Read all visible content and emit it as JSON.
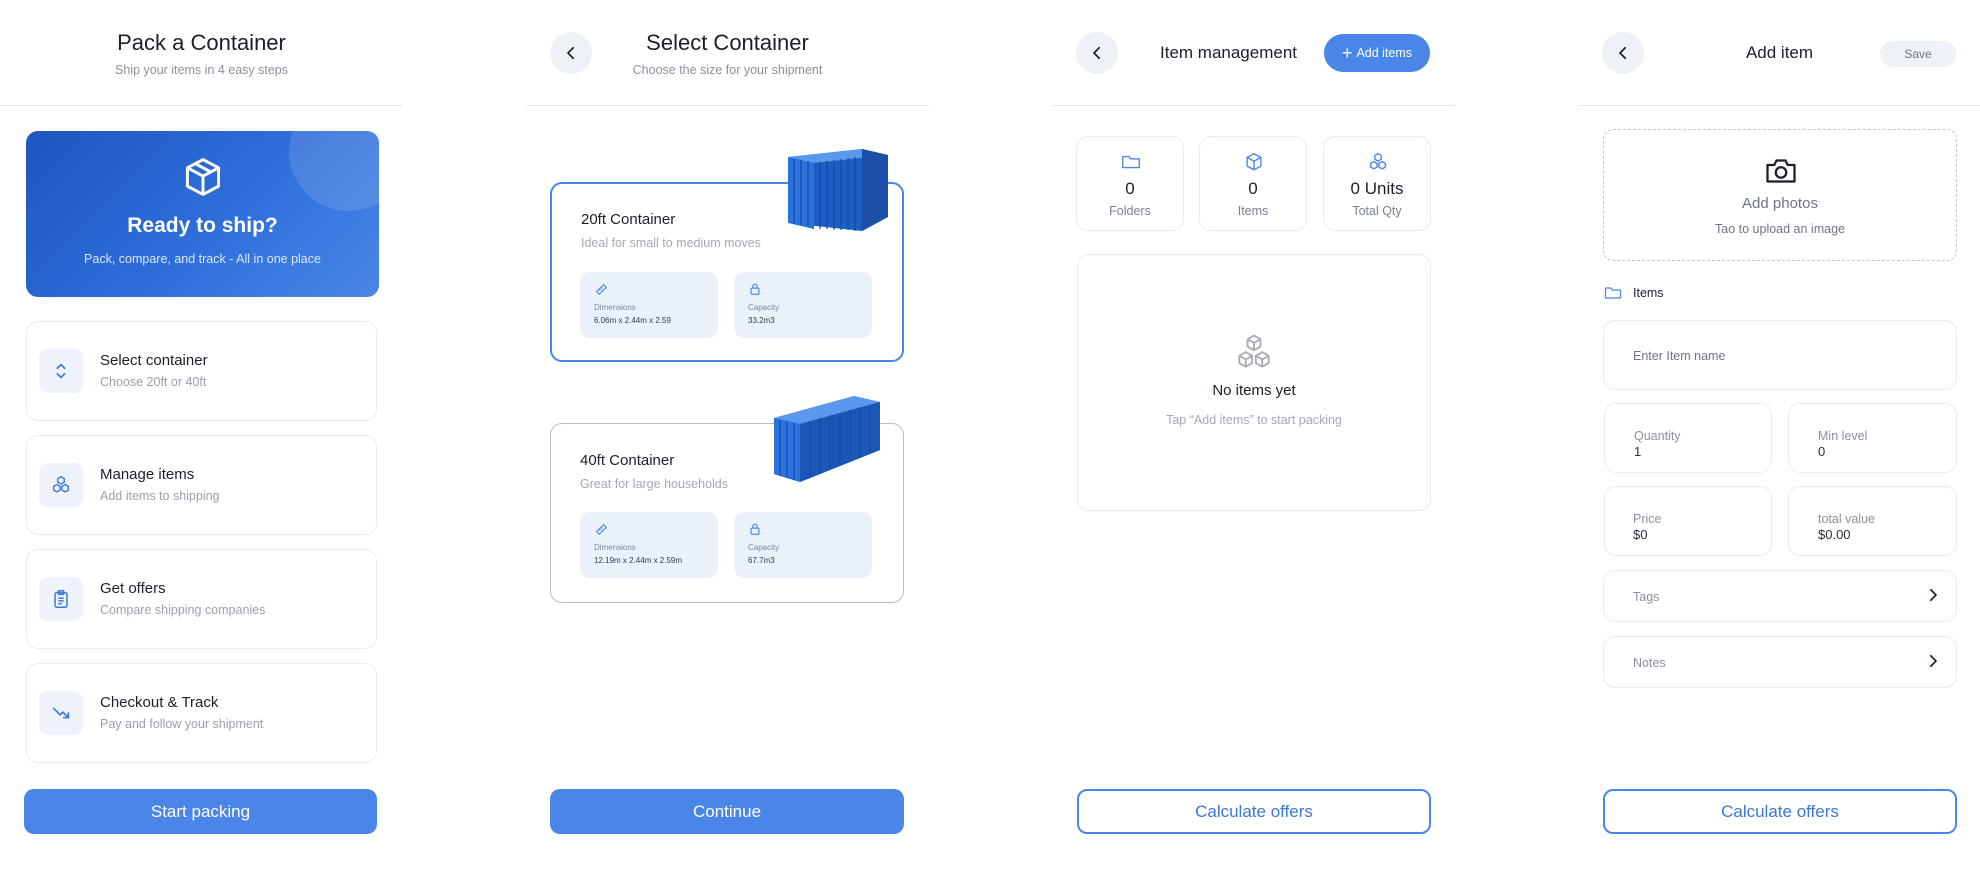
{
  "colors": {
    "accent": "#4a86e8",
    "hero_dark": "#1f56bf"
  },
  "screen1": {
    "title": "Pack a Container",
    "subtitle": "Ship your items in 4 easy  steps",
    "hero": {
      "title": "Ready to ship?",
      "subtitle": "Pack, compare, and track - All in one place",
      "icon": "box-icon"
    },
    "steps": [
      {
        "title": "Select container",
        "subtitle": "Choose 20ft or 40ft",
        "icon": "chevrons-up-down-icon"
      },
      {
        "title": "Manage items",
        "subtitle": "Add items to shipping",
        "icon": "boxes-stack-icon"
      },
      {
        "title": "Get offers",
        "subtitle": "Compare shipping companies",
        "icon": "clipboard-icon"
      },
      {
        "title": "Checkout & Track",
        "subtitle": "Pay and follow your shipment",
        "icon": "trending-arrow-icon"
      }
    ],
    "cta": "Start packing"
  },
  "screen2": {
    "title": "Select Container",
    "subtitle": "Choose the size for your shipment",
    "containers": [
      {
        "title": "20ft Container",
        "subtitle": "Ideal for small to medium moves",
        "dim_label": "Dimensions",
        "dim_value": "6.06m x 2.44m x 2.59",
        "cap_label": "Capacity",
        "cap_value": "33.2m3",
        "selected": true
      },
      {
        "title": "40ft Container",
        "subtitle": "Great for large households",
        "dim_label": "Dimensions",
        "dim_value": "12.19m x 2.44m x 2.59m",
        "cap_label": "Capacity",
        "cap_value": "67.7m3",
        "selected": false
      }
    ],
    "cta": "Continue"
  },
  "screen3": {
    "title": "Item management",
    "add_button": "Add items",
    "stats": [
      {
        "value": "0",
        "label": "Folders",
        "icon": "folder-icon"
      },
      {
        "value": "0",
        "label": "Items",
        "icon": "cube-icon"
      },
      {
        "value": "0 Units",
        "label": "Total Qty",
        "icon": "boxes-stack-icon"
      }
    ],
    "empty": {
      "title": "No items yet",
      "subtitle": "Tap “Add items” to start packing"
    },
    "cta": "Calculate offers"
  },
  "screen4": {
    "title": "Add item",
    "save": "Save",
    "upload": {
      "title": "Add photos",
      "subtitle": "Tao to upload an image"
    },
    "folder_label": "Items",
    "name_placeholder": "Enter Item name",
    "quantity": {
      "label": "Quantity",
      "value": "1"
    },
    "min_level": {
      "label": "Min level",
      "value": "0"
    },
    "price": {
      "label": "Price",
      "value": "$0"
    },
    "total_value": {
      "label": "total value",
      "value": "$0.00"
    },
    "tags": "Tags",
    "notes": "Notes",
    "cta": "Calculate offers"
  }
}
